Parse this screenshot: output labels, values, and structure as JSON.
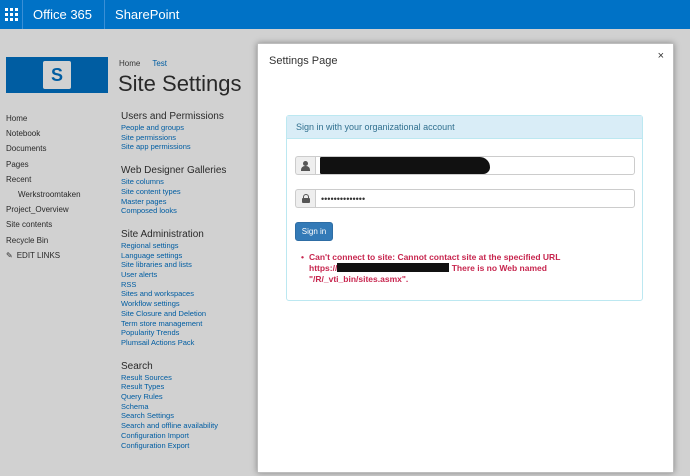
{
  "suitebar": {
    "brand": "Office 365",
    "site": "SharePoint",
    "accent": "#0072c6"
  },
  "header": {
    "logo_letter": "S",
    "breadcrumb_home": "Home",
    "breadcrumb_current": "Test",
    "title": "Site Settings"
  },
  "quicklaunch": {
    "items": [
      {
        "label": "Home"
      },
      {
        "label": "Notebook"
      },
      {
        "label": "Documents"
      },
      {
        "label": "Pages"
      },
      {
        "label": "Recent"
      },
      {
        "label": "Werkstroomtaken",
        "sub": true
      },
      {
        "label": "Project_Overview"
      },
      {
        "label": "Site contents"
      },
      {
        "label": "Recycle Bin"
      }
    ],
    "edit_links": "EDIT LINKS"
  },
  "settings": {
    "groups": [
      {
        "title": "Users and Permissions",
        "links": [
          "People and groups",
          "Site permissions",
          "Site app permissions"
        ]
      },
      {
        "title": "Web Designer Galleries",
        "links": [
          "Site columns",
          "Site content types",
          "Master pages",
          "Composed looks"
        ]
      },
      {
        "title": "Site Administration",
        "links": [
          "Regional settings",
          "Language settings",
          "Site libraries and lists",
          "User alerts",
          "RSS",
          "Sites and workspaces",
          "Workflow settings",
          "Site Closure and Deletion",
          "Term store management",
          "Popularity Trends",
          "Plumsail Actions Pack"
        ]
      },
      {
        "title": "Search",
        "links": [
          "Result Sources",
          "Result Types",
          "Query Rules",
          "Schema",
          "Search Settings",
          "Search and offline availability",
          "Configuration Import",
          "Configuration Export"
        ]
      }
    ]
  },
  "dialog": {
    "title": "Settings Page",
    "close": "×",
    "panel_heading": "Sign in with your organizational account",
    "password_value": "••••••••••••••",
    "signin_label": "Sign in",
    "error_line1": "Can't connect to site: Cannot contact site at the specified URL",
    "error_prefix": "https://",
    "error_after_redact": "There is no Web named",
    "error_line3": "\"/R/_vti_bin/sites.asmx\"."
  }
}
